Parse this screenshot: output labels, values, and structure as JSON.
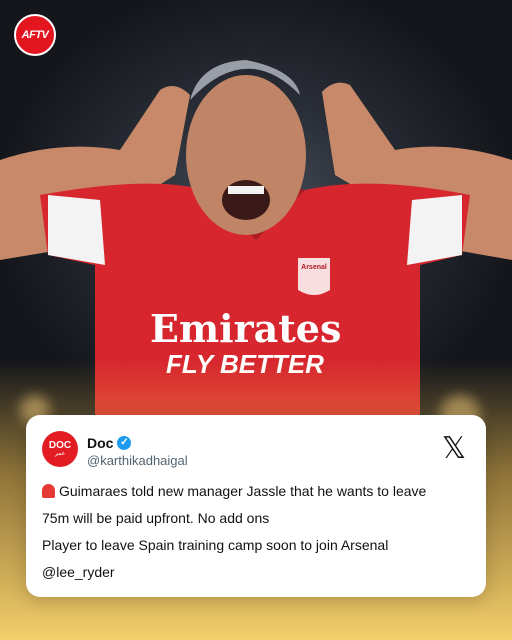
{
  "brand": {
    "logo_text": "AFTV"
  },
  "photo": {
    "jersey_sponsor_line1": "Emirates",
    "jersey_sponsor_line2": "FLY BETTER",
    "crest_text": "Arsenal"
  },
  "tweet": {
    "display_name": "Doc",
    "handle": "@karthikadhaigal",
    "avatar_text": "DOC",
    "avatar_subtext": "عمر",
    "lines": [
      "Guimaraes told new manager Jassle that he wants to leave",
      "75m will be paid upfront. No add ons",
      "Player to leave Spain training camp soon to join Arsenal",
      "@lee_ryder"
    ]
  },
  "colors": {
    "accent_red": "#e3151e",
    "verified_blue": "#1d9bf0",
    "glow": "#f5cf6a"
  }
}
